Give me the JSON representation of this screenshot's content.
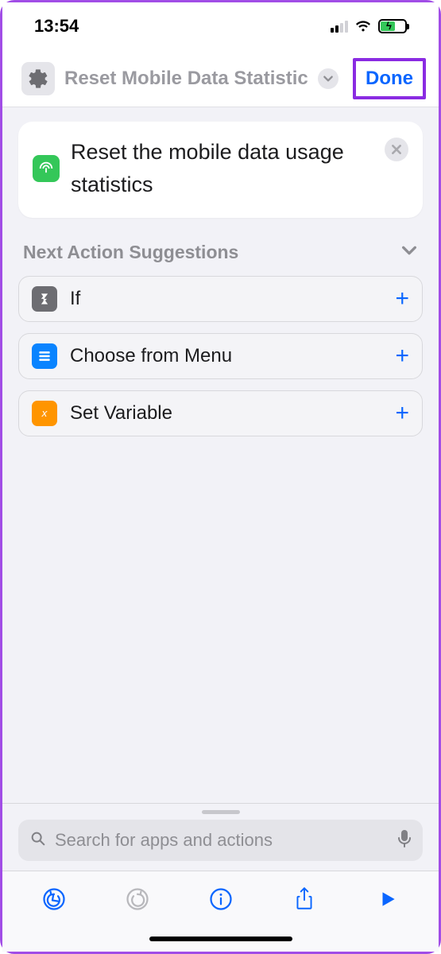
{
  "status": {
    "time": "13:54"
  },
  "nav": {
    "title": "Reset Mobile Data Statistics",
    "done_label": "Done"
  },
  "action": {
    "title": "Reset the mobile data usage statistics"
  },
  "suggestions": {
    "header": "Next Action Suggestions",
    "items": [
      {
        "label": "If"
      },
      {
        "label": "Choose from Menu"
      },
      {
        "label": "Set Variable"
      }
    ]
  },
  "search": {
    "placeholder": "Search for apps and actions"
  }
}
